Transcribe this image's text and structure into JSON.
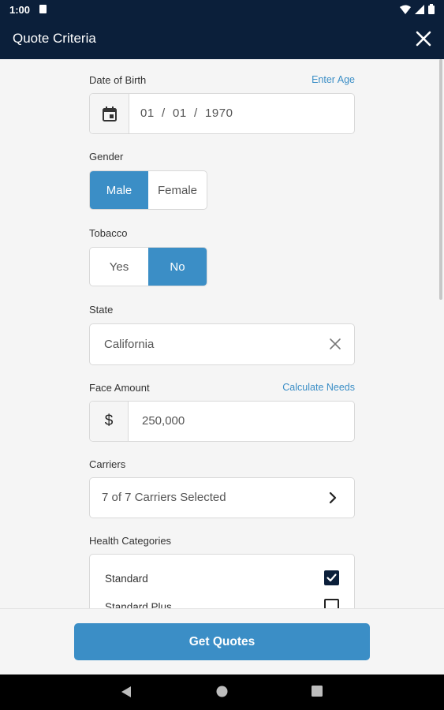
{
  "status_bar": {
    "time": "1:00"
  },
  "app_bar": {
    "title": "Quote Criteria"
  },
  "dob": {
    "label": "Date of Birth",
    "link": "Enter Age",
    "value": "01  /  01  /  1970"
  },
  "gender": {
    "label": "Gender",
    "options": [
      "Male",
      "Female"
    ],
    "selected": "Male"
  },
  "tobacco": {
    "label": "Tobacco",
    "options": [
      "Yes",
      "No"
    ],
    "selected": "No"
  },
  "state": {
    "label": "State",
    "value": "California"
  },
  "face_amount": {
    "label": "Face Amount",
    "link": "Calculate Needs",
    "prefix": "$",
    "value": "250,000"
  },
  "carriers": {
    "label": "Carriers",
    "value": "7 of 7 Carriers Selected"
  },
  "health": {
    "label": "Health Categories",
    "items": [
      {
        "label": "Standard",
        "checked": true
      },
      {
        "label": "Standard Plus",
        "checked": false
      }
    ]
  },
  "footer": {
    "button": "Get Quotes"
  },
  "colors": {
    "primary": "#3b8ec6",
    "header": "#0b1f3a"
  },
  "icons": [
    "calendar-icon",
    "close-icon",
    "clear-icon",
    "chevron-right-icon",
    "checkbox-checked-icon",
    "back-icon",
    "home-icon",
    "recents-icon"
  ]
}
